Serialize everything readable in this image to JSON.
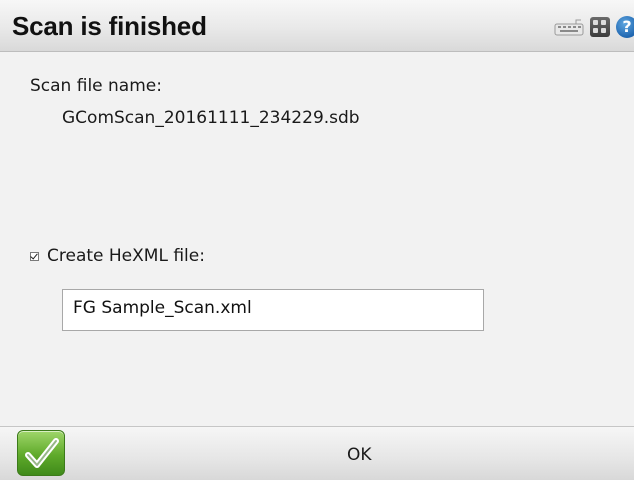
{
  "window": {
    "title": "Scan is finished"
  },
  "toolbar_icons": {
    "keyboard": "keyboard-icon",
    "grid": "grid-icon",
    "help": "help-icon",
    "help_glyph": "?"
  },
  "scan": {
    "file_name_label": "Scan file name:",
    "file_name_value": "GComScan_20161111_234229.sdb"
  },
  "hexml": {
    "checkbox_checked": true,
    "label": "Create HeXML file:",
    "file_value": "FG Sample_Scan.xml"
  },
  "footer": {
    "ok_label": "OK",
    "ok_icon": "checkmark-icon"
  },
  "colors": {
    "accent_green": "#5faa2a",
    "help_blue": "#1f66b0"
  }
}
